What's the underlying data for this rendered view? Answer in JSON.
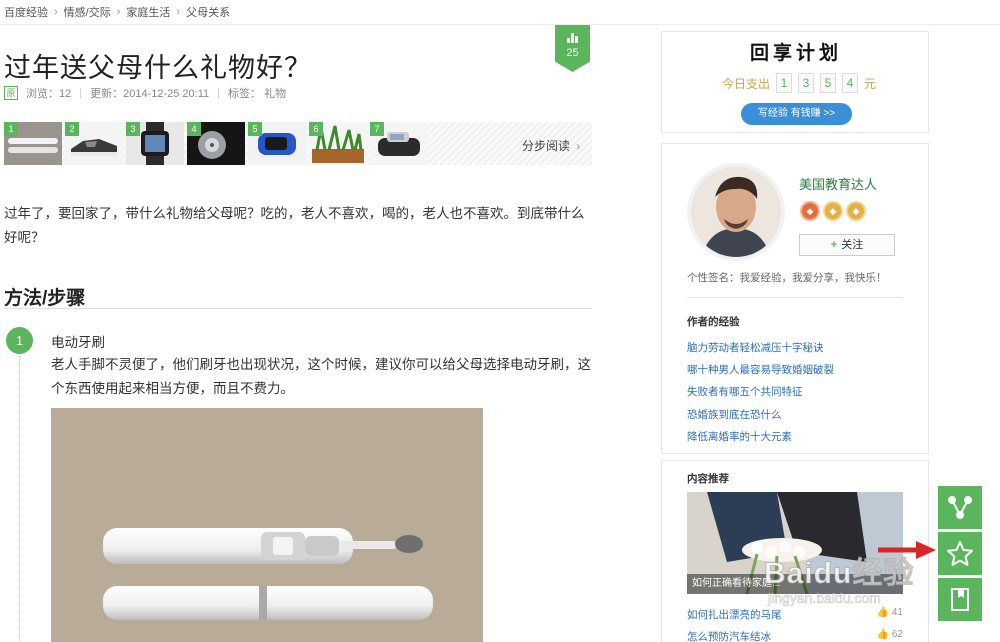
{
  "breadcrumb": [
    "百度经验",
    "情感/交际",
    "家庭生活",
    "父母关系"
  ],
  "article": {
    "title": "过年送父母什么礼物好？",
    "vote_count": "25",
    "original_badge": "原",
    "views": "浏览：12",
    "updated": "更新：2014-12-25 20:11",
    "tags": "标签：  礼物",
    "thumbs": [
      "1",
      "2",
      "3",
      "4",
      "5",
      "6",
      "7"
    ],
    "step_read": "分步阅读",
    "intro": "过年了，要回家了，带什么礼物给父母呢？吃的，老人不喜欢，喝的，老人也不喜欢。到底带什么好呢？",
    "section_title": "方法/步骤",
    "step_number": "1",
    "step_name": "电动牙刷",
    "step_text": "老人手脚不灵便了，他们刷牙也出现状况，这个时候，建议你可以给父母选择电动牙刷，这个东西使用起来相当方便，而且不费力。"
  },
  "sidebar": {
    "plan_title": "回享计划",
    "spent_label": "今日支出",
    "digits": [
      "1",
      "3",
      "5",
      "4"
    ],
    "unit": "元",
    "write_button": "写经验 有钱赚 >>",
    "author_name": "美国教育达人",
    "follow_label": "关注",
    "signature": "个性签名：我爱经验，我爱分享，我快乐！",
    "author_exp_title": "作者的经验",
    "author_exps": [
      "脑力劳动者轻松减压十字秘诀",
      "哪十种男人最容易导致婚姻破裂",
      "失败者有哪五个共同特征",
      "恐婚族到底在恐什么",
      "降低离婚率的十大元素"
    ],
    "rec_title": "内容推荐",
    "rec_caption": "如何正确看待家庭...",
    "recs": [
      {
        "title": "如何扎出漂亮的马尾",
        "count": "41"
      },
      {
        "title": "怎么预防汽车结冰",
        "count": "62"
      }
    ]
  },
  "watermark": {
    "text": "Baidu经验",
    "url": "jingyan.baidu.com"
  },
  "colors": {
    "accent": "#5ab55c",
    "link": "#2a6ebb",
    "button_blue": "#3b8fd6"
  },
  "icons": [
    "bar-chart-icon",
    "share-icon",
    "star-icon",
    "bookmark-icon",
    "chevron-right-icon",
    "plus-icon",
    "red-arrow-icon"
  ]
}
